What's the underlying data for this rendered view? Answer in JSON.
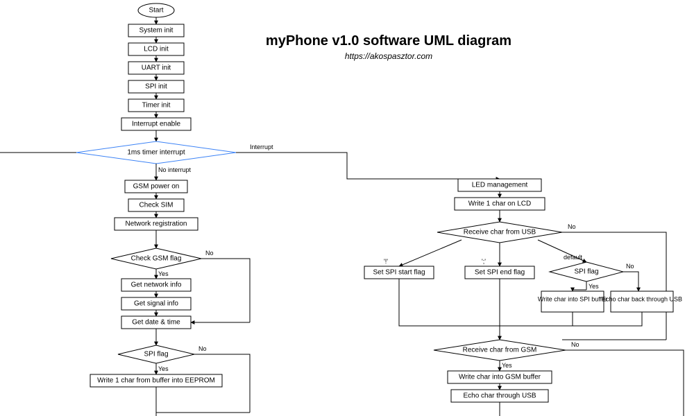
{
  "title": "myPhone v1.0 software UML diagram",
  "subtitle": "https://akospasztor.com",
  "nodes": {
    "start": "Start",
    "sys_init": "System init",
    "lcd_init": "LCD init",
    "uart_init": "UART init",
    "spi_init": "SPI init",
    "timer_init": "Timer init",
    "int_enable": "Interrupt enable",
    "timer_irq": "1ms timer interrupt",
    "gsm_power": "GSM power on",
    "check_sim": "Check SIM",
    "net_reg": "Network registration",
    "check_gsm": "Check GSM flag",
    "get_net": "Get network info",
    "get_signal": "Get signal info",
    "get_date": "Get date & time",
    "spi_flag_left": "SPI flag",
    "write_eeprom": "Write 1 char from buffer into EEPROM",
    "led_mgmt": "LED management",
    "write_lcd": "Write 1 char on LCD",
    "recv_usb": "Receive char from USB",
    "set_spi_start": "Set SPI start flag",
    "set_spi_end": "Set SPI end flag",
    "spi_flag_right": "SPI flag",
    "write_spi_buf": "Write char into SPI buffer",
    "echo_usb": "Echo char back through USB",
    "recv_gsm": "Receive char from GSM",
    "write_gsm_buf": "Write char into GSM buffer",
    "echo_gsm_usb": "Echo char through USB"
  },
  "edges": {
    "interrupt": "Interrupt",
    "no_interrupt": "No interrupt",
    "yes": "Yes",
    "no": "No",
    "default": "default",
    "exclaim": "'!'",
    "semi": "';'"
  }
}
